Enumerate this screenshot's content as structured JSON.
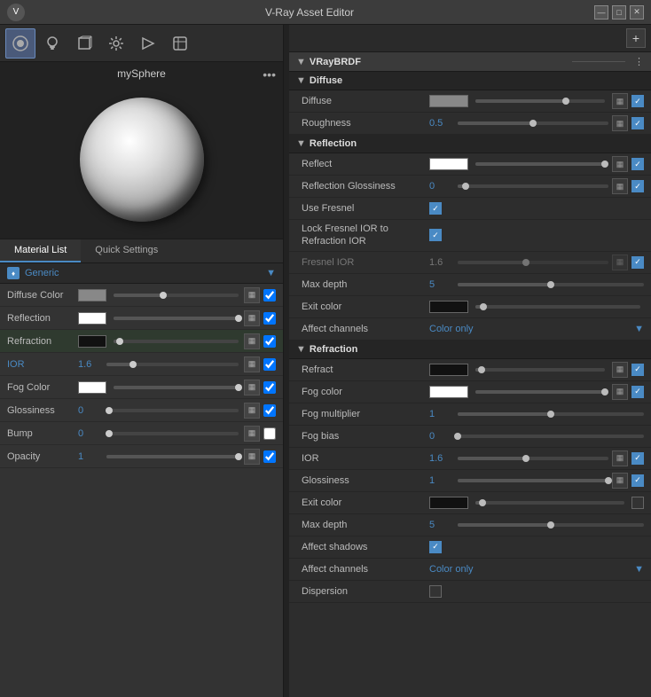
{
  "window": {
    "title": "V-Ray Asset Editor",
    "controls": [
      "—",
      "□",
      "✕"
    ]
  },
  "toolbar": {
    "tools": [
      {
        "name": "sphere-icon",
        "icon": "◎",
        "active": true
      },
      {
        "name": "light-icon",
        "icon": "💡",
        "active": false
      },
      {
        "name": "cube-icon",
        "icon": "◻",
        "active": false
      },
      {
        "name": "gear-icon",
        "icon": "⚙",
        "active": false
      },
      {
        "name": "teapot-icon",
        "icon": "☕",
        "active": false
      },
      {
        "name": "layers-icon",
        "icon": "▦",
        "active": false
      }
    ]
  },
  "preview": {
    "label": "mySphere"
  },
  "tabs": [
    {
      "label": "Material List"
    },
    {
      "label": "Quick Settings"
    }
  ],
  "material": {
    "icon": "♦",
    "name": "Generic"
  },
  "left_properties": [
    {
      "label": "Diffuse Color",
      "type": "swatch-slider",
      "swatch": "gray",
      "fill": 40
    },
    {
      "label": "Reflection",
      "type": "swatch-slider",
      "swatch": "white",
      "fill": 100
    },
    {
      "label": "Refraction",
      "type": "swatch-slider",
      "swatch": "black",
      "fill": 5
    },
    {
      "label": "IOR",
      "type": "value-slider",
      "value": "1.6",
      "fill": 20
    },
    {
      "label": "Fog Color",
      "type": "swatch-slider",
      "swatch": "white",
      "fill": 100
    },
    {
      "label": "Glossiness",
      "type": "value-slider",
      "value": "0",
      "fill": 2
    },
    {
      "label": "Bump",
      "type": "value-slider",
      "value": "0",
      "fill": 2
    },
    {
      "label": "Opacity",
      "type": "value-slider",
      "value": "1",
      "fill": 100
    }
  ],
  "right": {
    "brdf_title": "VRayBRDF",
    "sections": {
      "diffuse": {
        "title": "Diffuse",
        "rows": [
          {
            "label": "Diffuse",
            "type": "swatch-slider",
            "swatch": "gray",
            "fill": 70,
            "has_check": true
          },
          {
            "label": "Roughness",
            "type": "value-slider",
            "value": "0.5",
            "fill": 50,
            "has_check": true
          }
        ]
      },
      "reflection": {
        "title": "Reflection",
        "rows": [
          {
            "label": "Reflect",
            "type": "swatch-slider",
            "swatch": "white",
            "fill": 100,
            "has_check": true
          },
          {
            "label": "Reflection Glossiness",
            "type": "value-slider",
            "value": "0",
            "fill": 5,
            "has_check": true
          },
          {
            "label": "Use Fresnel",
            "type": "checkbox",
            "checked": true
          },
          {
            "label": "Lock Fresnel IOR to Refraction IOR",
            "type": "checkbox",
            "checked": true
          },
          {
            "label": "Fresnel IOR",
            "type": "value-slider-dim",
            "value": "1.6",
            "fill": 45,
            "dimmed": true,
            "has_check": true
          },
          {
            "label": "Max depth",
            "type": "value-slider",
            "value": "5",
            "fill": 50,
            "has_check": false
          },
          {
            "label": "Exit color",
            "type": "swatch-slider",
            "swatch": "black",
            "fill": 5,
            "has_check": false
          },
          {
            "label": "Affect channels",
            "type": "dropdown",
            "value": "Color only"
          }
        ]
      },
      "refraction": {
        "title": "Refraction",
        "rows": [
          {
            "label": "Refract",
            "type": "swatch-slider",
            "swatch": "black",
            "fill": 5,
            "has_check": true
          },
          {
            "label": "Fog color",
            "type": "swatch-slider",
            "swatch": "white",
            "fill": 100,
            "has_check": true
          },
          {
            "label": "Fog multiplier",
            "type": "value-slider",
            "value": "1",
            "fill": 50,
            "has_check": false
          },
          {
            "label": "Fog bias",
            "type": "value-slider",
            "value": "0",
            "fill": 0,
            "has_check": false
          },
          {
            "label": "IOR",
            "type": "value-slider",
            "value": "1.6",
            "fill": 45,
            "has_check": true
          },
          {
            "label": "Glossiness",
            "type": "value-slider",
            "value": "1",
            "fill": 100,
            "has_check": true
          },
          {
            "label": "Exit color",
            "type": "swatch-slider",
            "swatch": "black",
            "fill": 5,
            "has_check": false,
            "no_check": true
          },
          {
            "label": "Max depth",
            "type": "value-slider",
            "value": "5",
            "fill": 50,
            "has_check": false
          },
          {
            "label": "Affect shadows",
            "type": "checkbox",
            "checked": true
          },
          {
            "label": "Affect channels",
            "type": "dropdown",
            "value": "Color only"
          },
          {
            "label": "Dispersion",
            "type": "checkbox",
            "checked": false
          }
        ]
      }
    }
  }
}
